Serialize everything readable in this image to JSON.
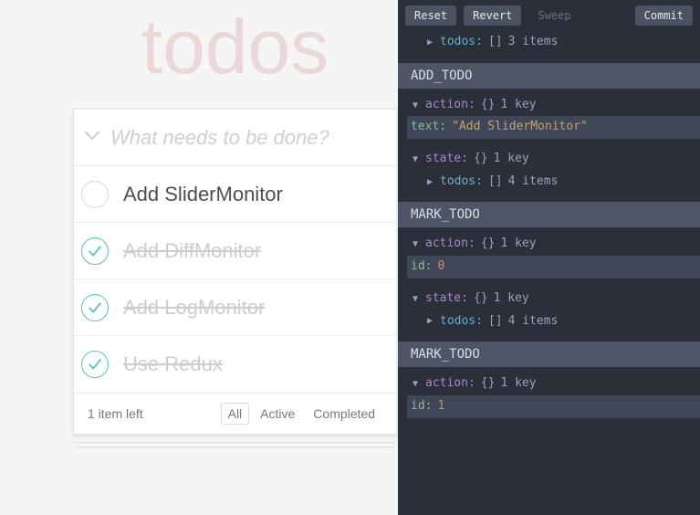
{
  "app": {
    "title": "todos",
    "new_todo_placeholder": "What needs to be done?"
  },
  "todos": [
    {
      "label": "Add SliderMonitor",
      "completed": false
    },
    {
      "label": "Add DiffMonitor",
      "completed": true
    },
    {
      "label": "Add LogMonitor",
      "completed": true
    },
    {
      "label": "Use Redux",
      "completed": true
    }
  ],
  "footer": {
    "count_text": "1 item left",
    "filters": {
      "all": "All",
      "active": "Active",
      "completed": "Completed"
    },
    "selected_filter": "all"
  },
  "devtools": {
    "toolbar": {
      "reset": "Reset",
      "revert": "Revert",
      "sweep": "Sweep",
      "commit": "Commit"
    },
    "glyphs": {
      "caret_down": "▼",
      "caret_right": "▶",
      "braces": "{}",
      "brackets": "[]"
    },
    "partial_top": {
      "todos_key": "todos:",
      "items_meta": "3 items"
    },
    "entries": [
      {
        "type": "ADD_TODO",
        "action_key": "action:",
        "action_meta": "1 key",
        "field_key": "text:",
        "field_value_str": "\"Add SliderMonitor\"",
        "state_key": "state:",
        "state_meta": "1 key",
        "todos_key": "todos:",
        "items_meta": "4 items"
      },
      {
        "type": "MARK_TODO",
        "action_key": "action:",
        "action_meta": "1 key",
        "field_key": "id:",
        "field_value_num": "0",
        "state_key": "state:",
        "state_meta": "1 key",
        "todos_key": "todos:",
        "items_meta": "4 items"
      },
      {
        "type": "MARK_TODO",
        "action_key": "action:",
        "action_meta": "1 key",
        "field_key": "id:",
        "field_value_num": "1"
      }
    ]
  }
}
